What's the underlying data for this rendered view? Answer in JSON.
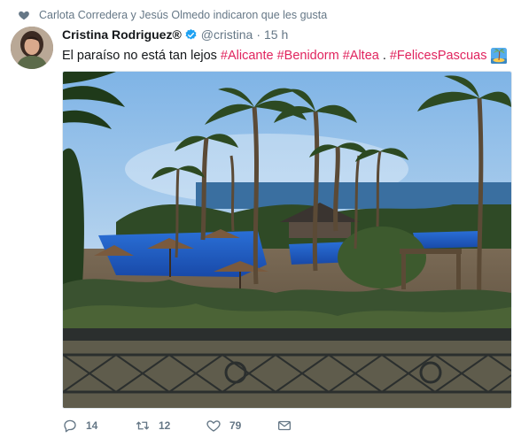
{
  "social_context": {
    "text": "Carlota Corredera y Jesús Olmedo indicaron que les gusta"
  },
  "tweet": {
    "display_name": "Cristina Rodriguez®",
    "handle": "@cristina",
    "separator": "·",
    "time": "15 h",
    "text_plain": "El paraíso no está tan lejos",
    "hashtags": [
      "#Alicante",
      "#Benidorm",
      "#Altea",
      ".",
      "#FelicesPascuas"
    ],
    "emoji": "desert-island-emoji"
  },
  "actions": {
    "reply_count": "14",
    "retweet_count": "12",
    "like_count": "79"
  },
  "colors": {
    "hashtag": "#e0245e",
    "muted": "#657786",
    "verified": "#1da1f2"
  }
}
